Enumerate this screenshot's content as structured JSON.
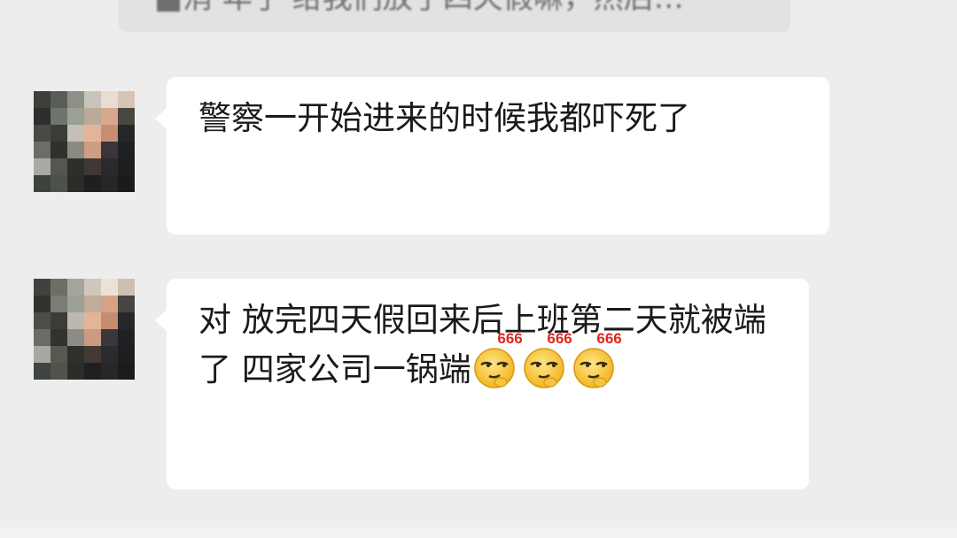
{
  "quote": {
    "text": "■消 年了 给我们放了四天假嘛，然后…"
  },
  "messages": [
    {
      "text": "警察一开始进来的时候我都吓死了",
      "emojis": []
    },
    {
      "text": "对 放完四天假回来后上班第二天就被端了 四家公司一锅端",
      "emojis": [
        {
          "icon": "smirk-666-emoji",
          "label": "666"
        },
        {
          "icon": "smirk-666-emoji",
          "label": "666"
        },
        {
          "icon": "smirk-666-emoji",
          "label": "666"
        }
      ]
    }
  ],
  "colors": {
    "background": "#ededed",
    "bubble": "#ffffff",
    "text": "#1a1a1a",
    "emoji_tag": "#e0261d"
  }
}
